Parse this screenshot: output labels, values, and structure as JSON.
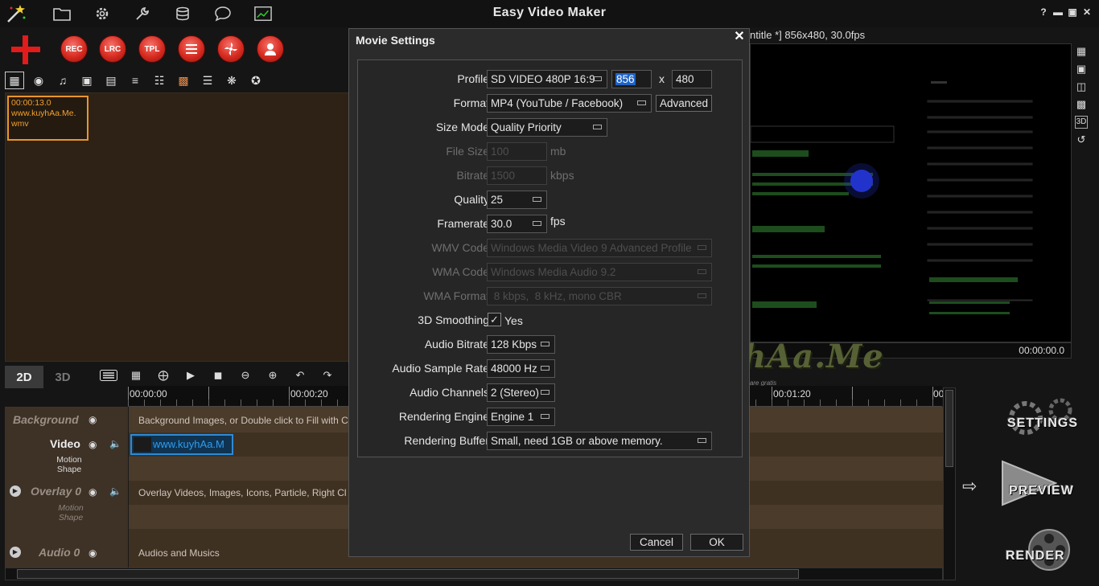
{
  "app": {
    "title": "Easy Video Maker",
    "window_controls": [
      "?",
      "▬",
      "▣",
      "✕"
    ]
  },
  "toolbar": {
    "icons": [
      "folder-icon",
      "gear-icon",
      "wrench-icon",
      "database-icon",
      "chat-icon",
      "chart-icon"
    ],
    "round_buttons": [
      "REC",
      "LRC",
      "TPL",
      "LIST",
      "FAN",
      "USER"
    ]
  },
  "library": {
    "clip": {
      "duration": "00:00:13.0",
      "name": "www.kuyhAa.Me.\nwmv"
    }
  },
  "preview": {
    "title": "ntitle *]   856x480, 30.0fps",
    "time": "00:00:00.0"
  },
  "timeline": {
    "tabs": [
      "2D",
      "3D"
    ],
    "ruler": [
      "00:00:00",
      "00:00:20",
      "00:01:20",
      "00"
    ],
    "tracks": {
      "background": {
        "name": "Background",
        "hint": "Background Images, or Double click to Fill with C"
      },
      "video": {
        "name": "Video",
        "sub1": "Motion",
        "sub2": "Shape",
        "clip": "www.kuyhAa.M"
      },
      "overlay": {
        "name": "Overlay 0",
        "sub1": "Motion",
        "sub2": "Shape",
        "hint": "Overlay Videos, Images, Icons, Particle, Right Cl"
      },
      "audio": {
        "name": "Audio 0",
        "hint": "Audios and Musics"
      }
    }
  },
  "actions": {
    "settings": "SETTINGS",
    "preview": "PREVIEW",
    "render": "RENDER"
  },
  "watermark": {
    "text": "kuyhAa.Me",
    "sub": "Free download software gratis"
  },
  "dialog": {
    "title": "Movie Settings",
    "close": "✕",
    "profile": {
      "label": "Profile",
      "value": "SD VIDEO 480P 16:9",
      "width": "856",
      "height": "480",
      "x": "x"
    },
    "format": {
      "label": "Format",
      "value": "MP4 (YouTube / Facebook)",
      "advanced": "Advanced"
    },
    "size_mode": {
      "label": "Size Mode",
      "value": "Quality Priority"
    },
    "file_size": {
      "label": "File Size",
      "value": "100",
      "unit": "mb"
    },
    "bitrate": {
      "label": "Bitrate",
      "value": "1500",
      "unit": "kbps"
    },
    "quality": {
      "label": "Quality",
      "value": "25"
    },
    "framerate": {
      "label": "Framerate",
      "value": "30.0",
      "unit": "fps"
    },
    "wmv_code": {
      "label": "WMV Code",
      "value": "Windows Media Video 9 Advanced Profile"
    },
    "wma_code": {
      "label": "WMA Code",
      "value": "Windows Media Audio 9.2"
    },
    "wma_format": {
      "label": "WMA Format",
      "value": " 8 kbps,  8 kHz, mono CBR"
    },
    "smoothing": {
      "label": "3D Smoothing",
      "check": "✓",
      "value": "Yes"
    },
    "audio_bitrate": {
      "label": "Audio Bitrate",
      "value": "128 Kbps"
    },
    "audio_rate": {
      "label": "Audio Sample Rate",
      "value": "48000 Hz"
    },
    "audio_channels": {
      "label": "Audio Channels",
      "value": "2 (Stereo)"
    },
    "engine": {
      "label": "Rendering Engine",
      "value": "Engine 1"
    },
    "buffer": {
      "label": "Rendering Buffer",
      "value": "Small, need 1GB or above memory."
    },
    "cancel": "Cancel",
    "ok": "OK"
  }
}
